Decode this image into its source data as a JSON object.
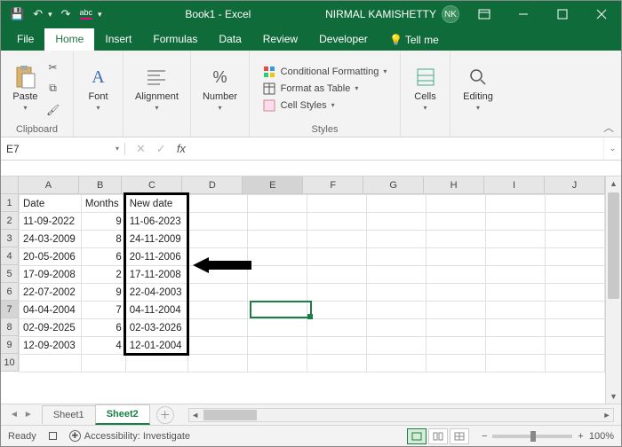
{
  "title": "Book1 - Excel",
  "user": {
    "name": "NIRMAL KAMISHETTY",
    "initials": "NK"
  },
  "qat": {
    "save": "💾",
    "undo": "↶",
    "redo": "↷",
    "spell": "abc"
  },
  "tabs": {
    "file": "File",
    "home": "Home",
    "insert": "Insert",
    "formulas": "Formulas",
    "data": "Data",
    "review": "Review",
    "developer": "Developer",
    "tellme": "Tell me"
  },
  "ribbon": {
    "clipboard": {
      "paste": "Paste",
      "label": "Clipboard"
    },
    "font": {
      "btn": "Font",
      "label": "Font"
    },
    "alignment": {
      "btn": "Alignment",
      "label": ""
    },
    "number": {
      "btn": "Number",
      "label": ""
    },
    "styles": {
      "cond": "Conditional Formatting",
      "table": "Format as Table",
      "cell": "Cell Styles",
      "label": "Styles"
    },
    "cells": {
      "btn": "Cells"
    },
    "editing": {
      "btn": "Editing"
    }
  },
  "namebox": "E7",
  "formula": "",
  "columns": [
    "A",
    "B",
    "C",
    "D",
    "E",
    "F",
    "G",
    "H",
    "I",
    "J"
  ],
  "rows": [
    "1",
    "2",
    "3",
    "4",
    "5",
    "6",
    "7",
    "8",
    "9",
    "10"
  ],
  "headers": {
    "a": "Date",
    "b": "Months",
    "c": "New date"
  },
  "data_rows": [
    {
      "a": "11-09-2022",
      "b": "9",
      "c": "11-06-2023"
    },
    {
      "a": "24-03-2009",
      "b": "8",
      "c": "24-11-2009"
    },
    {
      "a": "20-05-2006",
      "b": "6",
      "c": "20-11-2006"
    },
    {
      "a": "17-09-2008",
      "b": "2",
      "c": "17-11-2008"
    },
    {
      "a": "22-07-2002",
      "b": "9",
      "c": "22-04-2003"
    },
    {
      "a": "04-04-2004",
      "b": "7",
      "c": "04-11-2004"
    },
    {
      "a": "02-09-2025",
      "b": "6",
      "c": "02-03-2026"
    },
    {
      "a": "12-09-2003",
      "b": "4",
      "c": "12-01-2004"
    }
  ],
  "sheets": {
    "s1": "Sheet1",
    "s2": "Sheet2"
  },
  "status": {
    "ready": "Ready",
    "acc": "Accessibility: Investigate",
    "zoom": "100%"
  }
}
